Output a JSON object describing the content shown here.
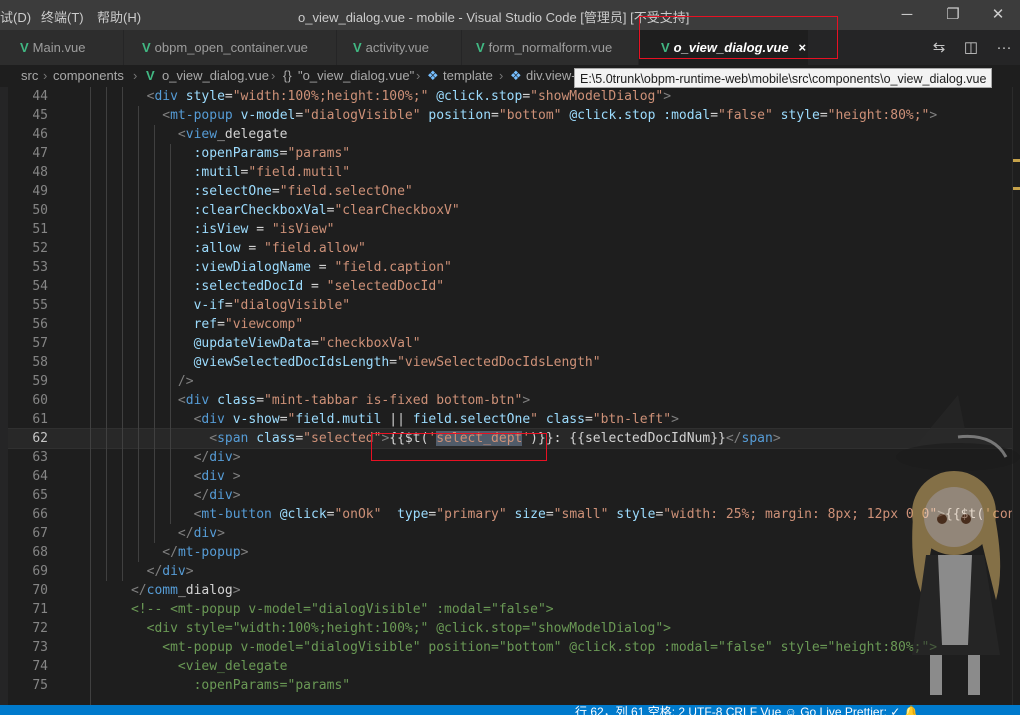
{
  "titlebar": {
    "menus": [
      "试(D)",
      "终端(T)",
      "帮助(H)"
    ],
    "title": "o_view_dialog.vue - mobile - Visual Studio Code [管理员] [不受支持]",
    "minimize": "─",
    "maximize": "❐",
    "close": "✕"
  },
  "tabs": [
    {
      "label": "Main.vue",
      "active": false
    },
    {
      "label": "obpm_open_container.vue",
      "active": false
    },
    {
      "label": "activity.vue",
      "active": false
    },
    {
      "label": "form_normalform.vue",
      "active": false
    },
    {
      "label": "o_view_dialog.vue",
      "active": true
    }
  ],
  "tab_icon": "V",
  "tab_close": "×",
  "tab_actions": {
    "compare": "⇆",
    "split": "◫",
    "more": "···"
  },
  "breadcrumb": {
    "items": [
      "src",
      "components",
      "o_view_dialog.vue",
      "\"o_view_dialog.vue\"",
      "template",
      "div.view-"
    ],
    "separator": "›",
    "braces_icon": "{}"
  },
  "tooltip": "E:\\5.0trunk\\obpm-runtime-web\\mobile\\src\\components\\o_view_dialog.vue",
  "editor": {
    "active_line": 62,
    "lines": [
      {
        "n": "44"
      },
      {
        "n": "45"
      },
      {
        "n": "46"
      },
      {
        "n": "47"
      },
      {
        "n": "48"
      },
      {
        "n": "49"
      },
      {
        "n": "50"
      },
      {
        "n": "51"
      },
      {
        "n": "52"
      },
      {
        "n": "53"
      },
      {
        "n": "54"
      },
      {
        "n": "55"
      },
      {
        "n": "56"
      },
      {
        "n": "57"
      },
      {
        "n": "58"
      },
      {
        "n": "59"
      },
      {
        "n": "60"
      },
      {
        "n": "61"
      },
      {
        "n": "62"
      },
      {
        "n": "63"
      },
      {
        "n": "64"
      },
      {
        "n": "65"
      },
      {
        "n": "66"
      },
      {
        "n": "67"
      },
      {
        "n": "68"
      },
      {
        "n": "69"
      },
      {
        "n": "70"
      },
      {
        "n": "71"
      },
      {
        "n": "72"
      },
      {
        "n": "73"
      },
      {
        "n": "74"
      },
      {
        "n": "75"
      }
    ]
  },
  "colors": {
    "accent": "#007acc",
    "highlight_box": "#e81123",
    "vue_green": "#41b883",
    "tag": "#569cd6",
    "attribute": "#9cdcfe",
    "string": "#ce9178",
    "comment": "#6a9955"
  },
  "statusbar": {
    "text": "行 62，列 61    空格: 2    UTF-8    CRLF    Vue    ☺ Go Live    Prettier: ✓    🔔"
  }
}
